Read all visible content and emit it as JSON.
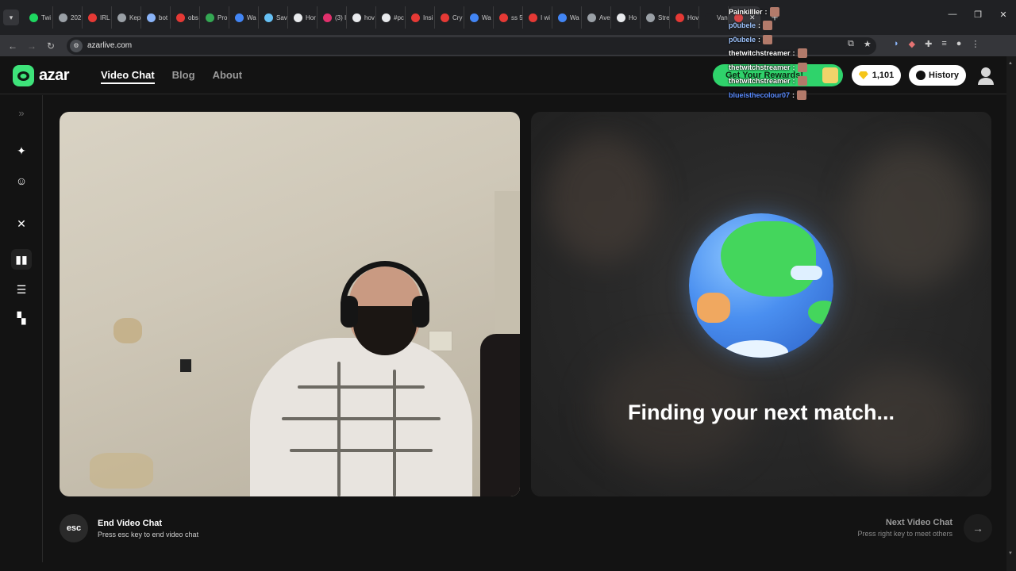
{
  "browser": {
    "tabs": [
      {
        "label": "Twi",
        "color": "#1ed760"
      },
      {
        "label": "202",
        "color": "#9aa0a6"
      },
      {
        "label": "IRL",
        "color": "#e53935"
      },
      {
        "label": "Kep",
        "color": "#9aa0a6"
      },
      {
        "label": "bot",
        "color": "#8ab4f8"
      },
      {
        "label": "obs",
        "color": "#e53935"
      },
      {
        "label": "Pro",
        "color": "#34a853"
      },
      {
        "label": "Wa",
        "color": "#4285f4"
      },
      {
        "label": "Sav",
        "color": "#66c0f4"
      },
      {
        "label": "Hor",
        "color": "#e8eaed"
      },
      {
        "label": "(3) I",
        "color": "#e1306c"
      },
      {
        "label": "hov",
        "color": "#e8eaed"
      },
      {
        "label": "#pc",
        "color": "#e8eaed"
      },
      {
        "label": "Insi",
        "color": "#e53935"
      },
      {
        "label": "Cry",
        "color": "#e53935"
      },
      {
        "label": "Wa",
        "color": "#4285f4"
      },
      {
        "label": "ss 5",
        "color": "#e53935"
      },
      {
        "label": "I wi",
        "color": "#e53935"
      },
      {
        "label": "Wa",
        "color": "#4285f4"
      },
      {
        "label": "Ave",
        "color": "#9aa0a6"
      },
      {
        "label": "Ho",
        "color": "#e8eaed"
      },
      {
        "label": "Stre",
        "color": "#9aa0a6"
      },
      {
        "label": "Hov",
        "color": "#e53935"
      },
      {
        "label": "Van",
        "color": "#202124"
      }
    ],
    "active_tab_label": "",
    "url": "azarlive.com"
  },
  "app": {
    "logo_text": "azar",
    "nav": [
      "Video Chat",
      "Blog",
      "About"
    ],
    "rewards_label": "Get Your Rewards!",
    "gems_count": "1,101",
    "history_label": "History",
    "finding_text": "Finding your next match...",
    "end_title": "End Video Chat",
    "end_sub": "Press esc key to end video chat",
    "esc_label": "esc",
    "next_title": "Next Video Chat",
    "next_sub": "Press right key to meet others",
    "accent": "#3ee37a"
  },
  "chat_overlay": [
    {
      "user": "Painkilller",
      "color": "#ffffff"
    },
    {
      "user": "p0ubele",
      "color": "#9fc5ff"
    },
    {
      "user": "p0ubele",
      "color": "#9fc5ff"
    },
    {
      "user": "thetwitchstreamer",
      "color": "#ffffff"
    },
    {
      "user": "thetwitchstreamer",
      "color": "#ffffff"
    },
    {
      "user": "thetwitchstreamer",
      "color": "#ffffff"
    },
    {
      "user": "blueisthecolour07",
      "color": "#5b8cff"
    }
  ]
}
